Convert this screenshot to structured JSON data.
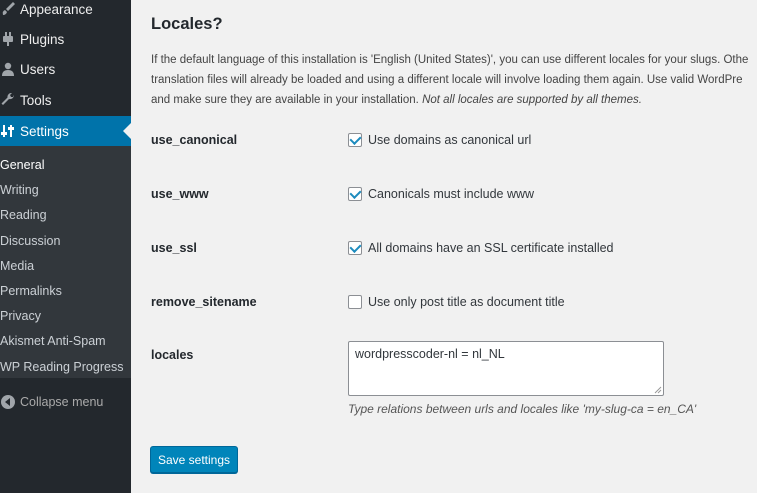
{
  "sidebar": {
    "items": [
      {
        "label": "Appearance",
        "icon": "paintbrush-icon"
      },
      {
        "label": "Plugins",
        "icon": "plugin-icon"
      },
      {
        "label": "Users",
        "icon": "users-icon"
      },
      {
        "label": "Tools",
        "icon": "wrench-icon"
      },
      {
        "label": "Settings",
        "icon": "settings-icon"
      }
    ],
    "submenu": [
      "General",
      "Writing",
      "Reading",
      "Discussion",
      "Media",
      "Permalinks",
      "Privacy",
      "Akismet Anti-Spam",
      "WP Reading Progress"
    ],
    "collapse_label": "Collapse menu"
  },
  "main": {
    "title": "Locales?",
    "description": {
      "line1": "If the default language of this installation is 'English (United States)', you can use different locales for your slugs. Othe",
      "line2": "translation files will already be loaded and using a different locale will involve loading them again. Use valid WordPre",
      "line3": "and make sure they are available in your installation.",
      "line3_em": "Not all locales are supported by all themes."
    },
    "rows": [
      {
        "label": "use_canonical",
        "checkbox_label": "Use domains as canonical url",
        "checked": true
      },
      {
        "label": "use_www",
        "checkbox_label": "Canonicals must include www",
        "checked": true
      },
      {
        "label": "use_ssl",
        "checkbox_label": "All domains have an SSL certificate installed",
        "checked": true
      },
      {
        "label": "remove_sitename",
        "checkbox_label": "Use only post title as document title",
        "checked": false
      }
    ],
    "locales": {
      "label": "locales",
      "value": "wordpresscoder-nl = nl_NL",
      "help": "Type relations between urls and locales like 'my-slug-ca = en_CA'"
    },
    "save_label": "Save settings"
  },
  "colors": {
    "sidebar_bg": "#23282d",
    "submenu_bg": "#32373c",
    "accent": "#0073aa",
    "button": "#0085ba",
    "content_bg": "#f1f1f1"
  }
}
